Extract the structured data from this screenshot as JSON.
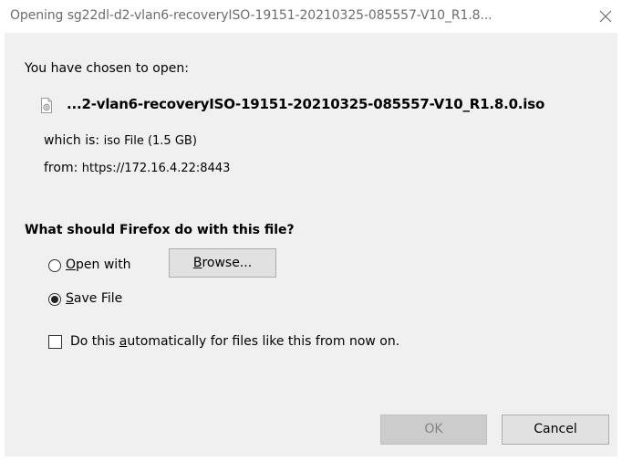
{
  "window": {
    "title": "Opening sg22dl-d2-vlan6-recoveryISO-19151-20210325-085557-V10_R1.8...",
    "close_icon": "close-icon"
  },
  "file": {
    "intro": "You have chosen to open:",
    "icon": "iso-file-icon",
    "name": "...2-vlan6-recoveryISO-19151-20210325-085557-V10_R1.8.0.iso",
    "which_label": "which is:",
    "which_value": "iso File (1.5 GB)",
    "from_label": "from:",
    "from_value": "https://172.16.4.22:8443"
  },
  "action": {
    "question": "What should Firefox do with this file?",
    "open_with": {
      "mnemonic": "O",
      "rest": "pen with",
      "selected": false
    },
    "browse_label": {
      "mnemonic": "B",
      "rest": "rowse..."
    },
    "save_file": {
      "mnemonic": "S",
      "rest": "ave File",
      "selected": true
    },
    "auto": {
      "before": "Do this ",
      "mnemonic": "a",
      "after": "utomatically for files like this from now on.",
      "checked": false
    }
  },
  "buttons": {
    "ok": "OK",
    "cancel": "Cancel"
  },
  "colors": {
    "dialog_bg": "#f0f0f0",
    "button_bg": "#e1e1e1",
    "disabled_text": "#838383"
  }
}
